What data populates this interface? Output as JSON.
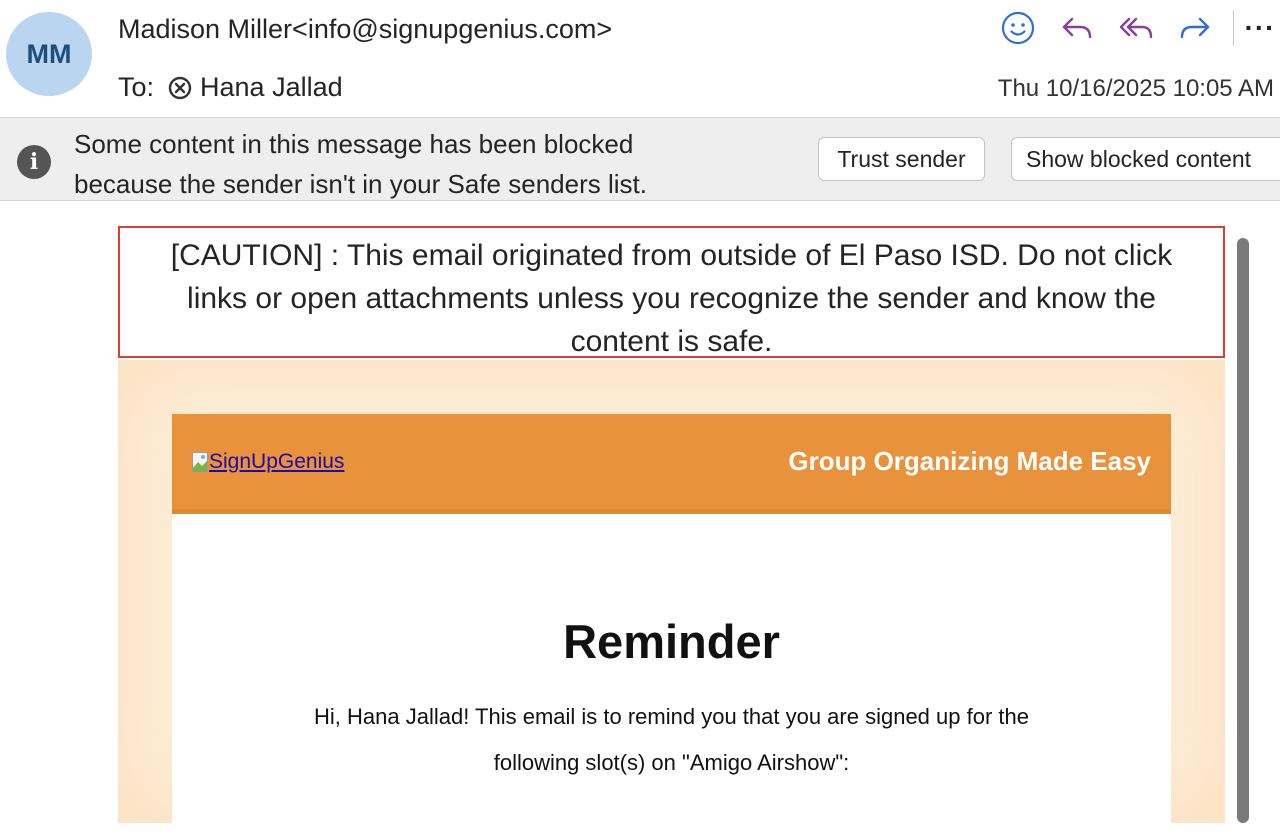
{
  "header": {
    "avatar_initials": "MM",
    "sender": "Madison Miller<info@signupgenius.com>",
    "to_label": "To:",
    "recipient": "Hana Jallad",
    "datetime": "Thu 10/16/2025 10:05 AM",
    "actions": [
      "smiley-icon",
      "reply-icon",
      "reply-all-icon",
      "forward-icon",
      "more-icon"
    ],
    "more_label": "···"
  },
  "infobar": {
    "line1": "Some content in this message has been blocked",
    "line2": "because the sender isn't in your Safe senders list.",
    "trust_button": "Trust sender",
    "show_button": "Show blocked content"
  },
  "caution": {
    "line1": "[CAUTION] : This email originated from outside of El Paso ISD. Do not click",
    "line2": "links or open attachments unless you recognize the sender and know the",
    "line3": "content is safe."
  },
  "email": {
    "logo_alt": "SignUpGenius",
    "tagline": "Group Organizing Made Easy",
    "title": "Reminder",
    "body_line1": "Hi, Hana Jallad! This email is to remind you that you are signed up for the",
    "body_line2": "following slot(s) on \"Amigo Airshow\":"
  },
  "colors": {
    "accent_action": "#8a3d9e",
    "forward": "#2f6fce",
    "caution_border": "#d9412f",
    "header_orange": "#e8923b",
    "avatar_bg": "#b9d5f0"
  }
}
